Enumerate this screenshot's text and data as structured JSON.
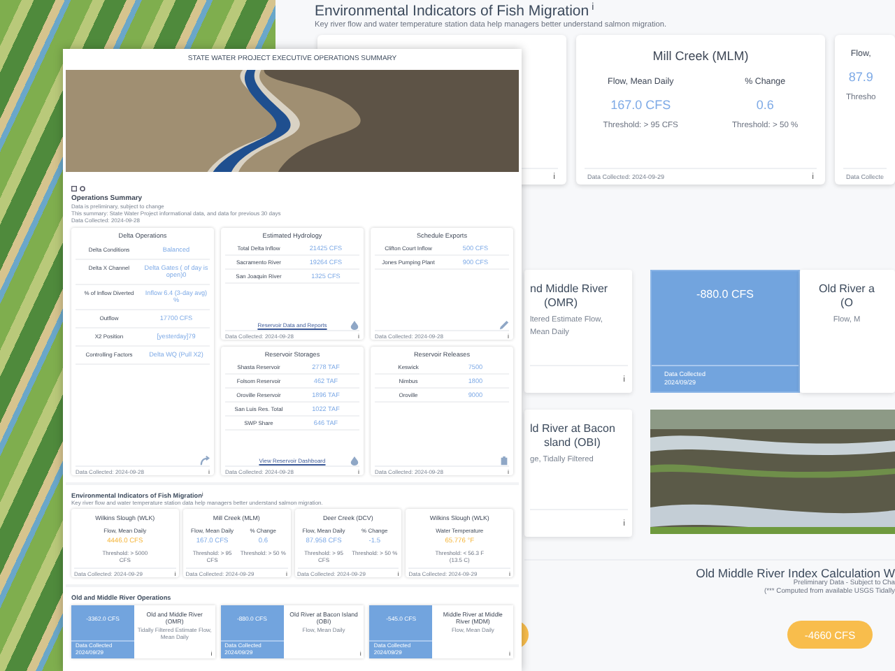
{
  "dashboard": {
    "title": "Environmental Indicators of Fish Migration",
    "title_info": "i",
    "subtitle": "Key river flow and water temperature station data help managers better understand salmon migration.",
    "cards": [
      {
        "info": "i"
      },
      {
        "name": "Mill Creek (MLM)",
        "metrics": [
          {
            "label": "Flow, Mean Daily",
            "value": "167.0 CFS",
            "alert": false,
            "threshold": "Threshold: > 95 CFS"
          },
          {
            "label": "% Change",
            "value": "0.6",
            "alert": false,
            "threshold": "Threshold: > 50 %"
          }
        ],
        "footer": "Data Collected: 2024-09-29",
        "info": "i"
      },
      {
        "metrics": [
          {
            "label": "Flow,",
            "value": "87.9",
            "alert": false,
            "threshold": "Thresho"
          }
        ],
        "footer": "Data Collecte"
      }
    ],
    "omr_rows": [
      [
        {
          "kind": "text",
          "name_lines": [
            "nd Middle River",
            "(OMR)"
          ],
          "desc_lines": [
            "ltered Estimate Flow,",
            "Mean Daily"
          ],
          "info": "i"
        },
        {
          "kind": "tile",
          "value": "-880.0 CFS",
          "footer_label": "Data Collected",
          "footer_date": "2024/09/29"
        },
        {
          "kind": "text",
          "name_lines": [
            "Old River a",
            "(O"
          ],
          "desc_lines": [
            "Flow, M"
          ]
        }
      ],
      [
        {
          "kind": "text",
          "name_lines": [
            "ld River at Bacon",
            "sland (OBI)"
          ],
          "desc_lines": [
            "ge, Tidally Filtered"
          ],
          "info": "i"
        },
        {
          "kind": "photo"
        }
      ]
    ],
    "index": {
      "title": "Old Middle River Index Calculation W",
      "notes": [
        "Preliminary Data - Subject to Cha",
        "(*** Computed from available USGS Tidally"
      ],
      "value": "-4660 CFS"
    }
  },
  "report": {
    "title": "STATE WATER PROJECT EXECUTIVE OPERATIONS SUMMARY",
    "summary": {
      "title": "Operations Summary",
      "lines": [
        "Data is preliminary, subject to change",
        "This summary: State Water Project informational data, and data for previous 30 days",
        "Data Collected: 2024-09-28"
      ]
    },
    "panels": [
      {
        "title": "Delta Operations",
        "rows": [
          {
            "label": "Delta Conditions",
            "value": "Balanced"
          },
          {
            "label": "Delta X Channel",
            "value": "Delta Gates ( of day is open)0"
          },
          {
            "label": "% of Inflow Diverted",
            "value": "Inflow 6.4 (3-day avg) %"
          },
          {
            "label": "Outflow",
            "value": "17700 CFS"
          },
          {
            "label": "X2 Position",
            "value": "[yesterday]79"
          },
          {
            "label": "Controlling Factors",
            "value": "Delta WQ (Pull X2)"
          }
        ],
        "footer": "Data Collected: 2024-09-28",
        "info": "i"
      },
      {
        "title": "Estimated Hydrology",
        "rows": [
          {
            "label": "Total Delta Inflow",
            "value": "21425 CFS"
          },
          {
            "label": "Sacramento River",
            "value": "19264 CFS"
          },
          {
            "label": "San Joaquin River",
            "value": "1325 CFS"
          }
        ],
        "link": "Reservoir Data and Reports",
        "footer": "Data Collected: 2024-09-28",
        "info": "i"
      },
      {
        "title": "Schedule Exports",
        "rows": [
          {
            "label": "Clifton Court Inflow",
            "value": "500 CFS"
          },
          {
            "label": "Jones Pumping Plant",
            "value": "900 CFS"
          }
        ],
        "footer": "Data Collected: 2024-09-28",
        "info": "i"
      },
      {
        "title": "Reservoir Storages",
        "rows": [
          {
            "label": "Shasta Reservoir",
            "value": "2778 TAF"
          },
          {
            "label": "Folsom Reservoir",
            "value": "462 TAF"
          },
          {
            "label": "Oroville Reservoir",
            "value": "1896 TAF"
          },
          {
            "label": "San Luis Res. Total",
            "value": "1022 TAF"
          },
          {
            "label": "SWP Share",
            "value": "646 TAF"
          }
        ],
        "link": "View Reservoir Dashboard",
        "footer": "Data Collected: 2024-09-28",
        "info": "i"
      },
      {
        "title": "Reservoir Releases",
        "rows": [
          {
            "label": "Keswick",
            "value": "7500"
          },
          {
            "label": "Nimbus",
            "value": "1800"
          },
          {
            "label": "Oroville",
            "value": "9000"
          }
        ],
        "footer": "Data Collected: 2024-09-28",
        "info": "i"
      }
    ],
    "fish": {
      "title": "Environmental Indicators of Fish Migration",
      "title_info": "i",
      "subtitle": "Key river flow and water temperature station data help managers better understand salmon migration.",
      "cards": [
        {
          "name": "Wilkins Slough (WLK)",
          "metrics": [
            {
              "label": "Flow, Mean Daily",
              "value": "4446.0 CFS",
              "alert": true,
              "threshold": "Threshold: > 5000 CFS"
            }
          ],
          "footer": "Data Collected: 2024-09-29",
          "info": "i"
        },
        {
          "name": "Mill Creek (MLM)",
          "metrics": [
            {
              "label": "Flow, Mean Daily",
              "value": "167.0 CFS",
              "alert": false,
              "threshold": "Threshold: > 95 CFS"
            },
            {
              "label": "% Change",
              "value": "0.6",
              "alert": false,
              "threshold": "Threshold: > 50 %"
            }
          ],
          "footer": "Data Collected: 2024-09-29",
          "info": "i"
        },
        {
          "name": "Deer Creek (DCV)",
          "metrics": [
            {
              "label": "Flow, Mean Daily",
              "value": "87.958 CFS",
              "alert": false,
              "threshold": "Threshold: > 95 CFS"
            },
            {
              "label": "% Change",
              "value": "-1.5",
              "alert": false,
              "threshold": "Threshold: > 50 %"
            }
          ],
          "footer": "Data Collected: 2024-09-29",
          "info": "i"
        },
        {
          "name": "Wilkins Slough (WLK)",
          "metrics": [
            {
              "label": "Water Temperature",
              "value": "65.776 °F",
              "alert": true,
              "threshold": "Threshold: < 56.3 F (13.5 C)"
            }
          ],
          "footer": "Data Collected: 2024-09-29",
          "info": "i"
        }
      ]
    },
    "omr": {
      "title": "Old and Middle River Operations",
      "cards": [
        {
          "value": "-3362.0 CFS",
          "footer_label": "Data Collected",
          "footer_date": "2024/09/29",
          "name": "Old and Middle River (OMR)",
          "desc": "Tidally Filtered Estimate Flow, Mean Daily",
          "info": "i"
        },
        {
          "value": "-880.0 CFS",
          "footer_label": "Data Collected",
          "footer_date": "2024/09/29",
          "name": "Old River at Bacon Island (OBI)",
          "desc": "Flow, Mean Daily",
          "info": "i"
        },
        {
          "value": "-545.0 CFS",
          "footer_label": "Data Collected",
          "footer_date": "2024/09/29",
          "name": "Middle River at Middle River (MDM)",
          "desc": "Flow, Mean Daily",
          "info": "i"
        }
      ]
    }
  }
}
